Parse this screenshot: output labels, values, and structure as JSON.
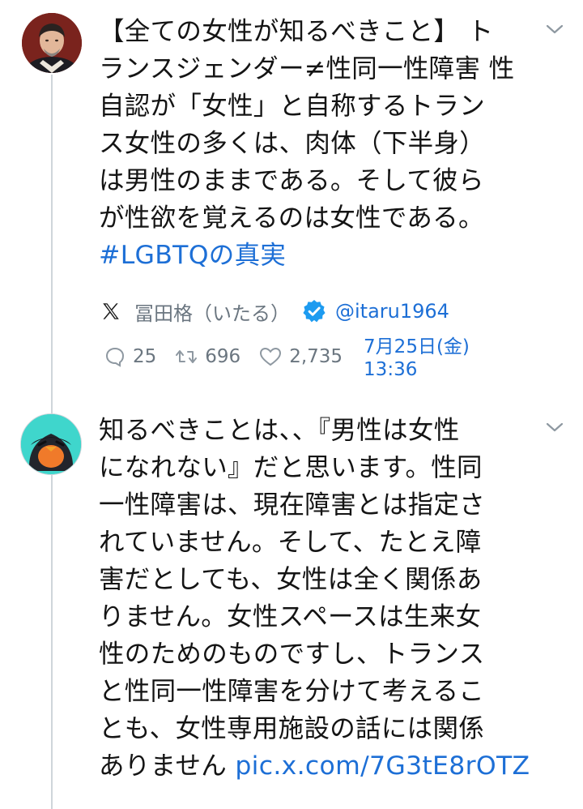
{
  "tweet1": {
    "text_lines": [
      "【全ての女性が知るべきこと】 ト",
      "ランスジェンダー≠性同一性障害 性",
      "自認が「女性」と自称するトラン",
      "ス女性の多くは、肉体（下半身）",
      "は男性のままである。そして彼ら",
      "が性欲を覚えるのは女性である。"
    ],
    "hashtag": "#LGBTQの真実",
    "author_name": "冨田格（いたる）",
    "handle": "@itaru1964",
    "replies": "25",
    "reposts": "696",
    "likes": "2,735",
    "date": "7月25日(金)",
    "time": "13:36"
  },
  "tweet2": {
    "text_lines": [
      "知るべきことは、、『男性は女性",
      "になれない』だと思います。性同",
      "一性障害は、現在障害とは指定さ",
      "れていません。そして、たとえ障",
      "害だとしても、女性は全く関係あ",
      "りません。女性スペースは生来女",
      "性のためのものですし、トランス",
      "と性同一性障害を分けて考えるこ",
      "とも、女性専用施設の話には関係"
    ],
    "last_line_prefix": "ありません",
    "link": "pic.x.com/7G3tE8rOTZ"
  },
  "colors": {
    "link": "#1d6fd6",
    "meta": "#6b7680",
    "verified": "#1d9bf0",
    "thread_line": "#cfd5da"
  },
  "icons": {
    "menu": "chevron-down-icon",
    "x_logo": "x-logo-icon",
    "verified": "verified-badge-icon",
    "reply": "reply-icon",
    "repost": "repost-icon",
    "like": "heart-icon"
  }
}
